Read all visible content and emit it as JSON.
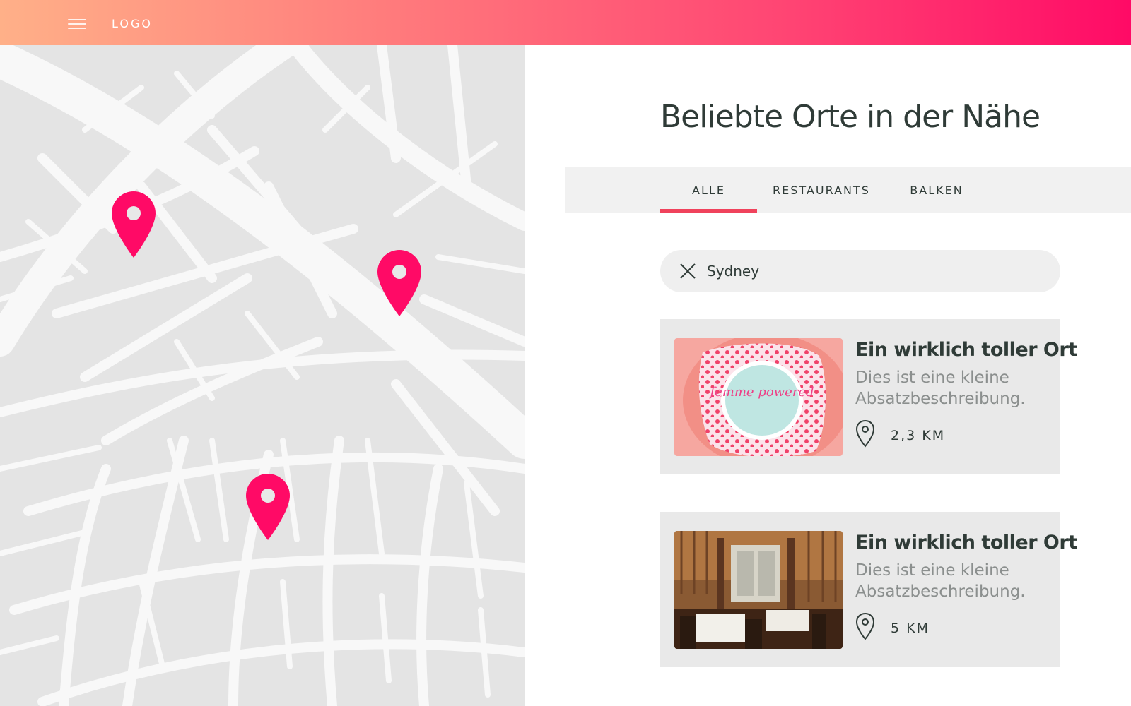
{
  "header": {
    "logo": "LOGO",
    "menu_icon": "hamburger-menu-icon",
    "gradient": [
      "#ffb088",
      "#ff0a66"
    ]
  },
  "map": {
    "pin_icon": "map-pin-icon",
    "pin_color": "#ff0a66",
    "road_color": "#f8f8f8",
    "block_color": "#e4e4e4"
  },
  "title": "Beliebte Orte in der Nähe",
  "tabs": [
    {
      "label": "ALLE",
      "active": true
    },
    {
      "label": "RESTAURANTS",
      "active": false
    },
    {
      "label": "BALKEN",
      "active": false
    }
  ],
  "accent_color": "#f0425c",
  "search": {
    "value": "Sydney",
    "clear_icon": "close-icon"
  },
  "cards": [
    {
      "title": "Ein wirklich toller Ort",
      "description": "Dies ist eine kleine Absatzbeschreibung.",
      "distance": "2,3 KM",
      "image": "cake-photo",
      "image_text": "femme powered"
    },
    {
      "title": "Ein wirklich toller Ort",
      "description": "Dies ist eine kleine Absatzbeschreibung.",
      "distance": "5 KM",
      "image": "restaurant-interior-photo"
    }
  ]
}
